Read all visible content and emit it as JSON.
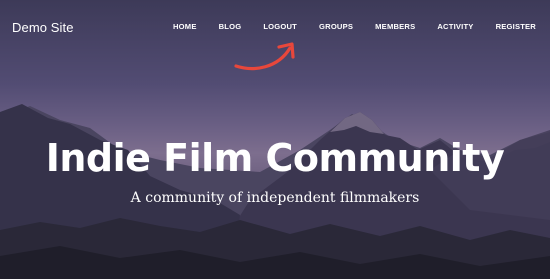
{
  "site": {
    "title": "Demo Site"
  },
  "nav": {
    "items": [
      "HOME",
      "BLOG",
      "LOGOUT",
      "GROUPS",
      "MEMBERS",
      "ACTIVITY",
      "REGISTER"
    ]
  },
  "hero": {
    "headline": "Indie Film Community",
    "tagline": "A community of independent filmmakers"
  },
  "colors": {
    "text": "#ffffff",
    "annotation_arrow": "#e8473b"
  }
}
